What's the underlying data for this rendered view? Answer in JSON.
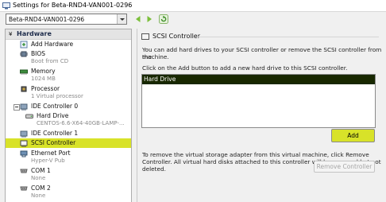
{
  "window": {
    "title": "Settings for Beta-RND4-VAN001-0296"
  },
  "vm_selector": {
    "value": "Beta-RND4-VAN001-0296"
  },
  "toolbar": {
    "back_icon": "back-arrow-icon",
    "forward_icon": "forward-arrow-icon",
    "refresh_icon": "refresh-icon"
  },
  "sidebar": {
    "header": {
      "expander": "¥",
      "label": "Hardware"
    },
    "items": [
      {
        "name": "Add Hardware",
        "sub": ""
      },
      {
        "name": "BIOS",
        "sub": "Boot from CD"
      },
      {
        "name": "Memory",
        "sub": "1024 MB"
      },
      {
        "name": "Processor",
        "sub": "1 Virtual processor"
      },
      {
        "name": "IDE Controller 0",
        "sub": ""
      },
      {
        "name": "Hard Drive",
        "sub": "CENTOS-6.6-X64-40GB-LAMP-..."
      },
      {
        "name": "IDE Controller 1",
        "sub": ""
      },
      {
        "name": "SCSI Controller",
        "sub": ""
      },
      {
        "name": "Ethernet Port",
        "sub": "Hyper-V Pub"
      },
      {
        "name": "COM 1",
        "sub": "None"
      },
      {
        "name": "COM 2",
        "sub": "None"
      }
    ]
  },
  "panel": {
    "title": "SCSI Controller",
    "intro_line1": "You can add hard drives to your SCSI controller or remove the SCSI controller from the",
    "intro_line2": "machine.",
    "add_instruction": "Click on the Add button to add a new hard drive to this SCSI controller.",
    "list_items": [
      "Hard Drive"
    ],
    "add_button": "Add",
    "remove_text_line1": "To remove the virtual storage adapter from this virtual machine, click Remove",
    "remove_text_line2": "Controller. All virtual hard disks attached to this controller will be removed but not",
    "remove_text_line3": "deleted.",
    "remove_button": "Remove Controller"
  },
  "colors": {
    "accent": "#d8e229",
    "list_selection": "#182800",
    "window_bg": "#f0f0f0"
  }
}
